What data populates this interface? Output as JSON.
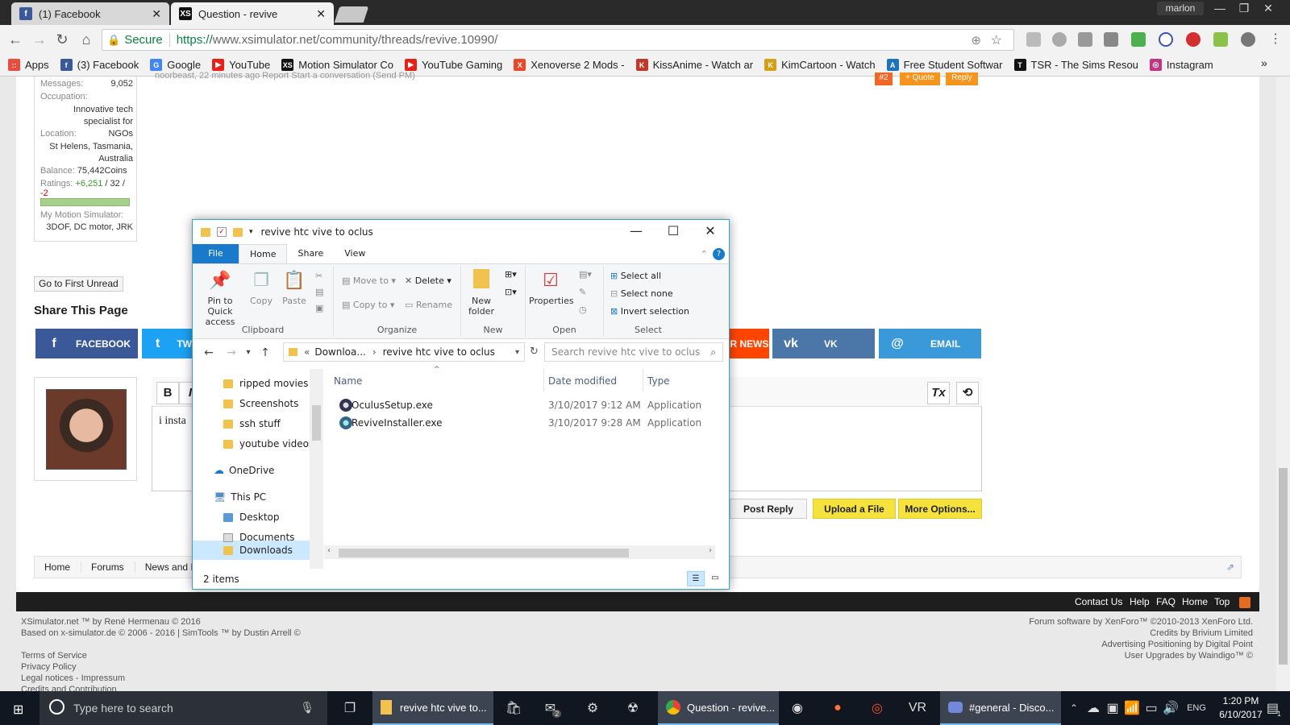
{
  "browser": {
    "tabs": [
      {
        "title": "(1) Facebook",
        "icon": "facebook-icon",
        "color": "#3b5998"
      },
      {
        "title": "Question - revive",
        "icon": "xs-icon",
        "color": "#111111"
      }
    ],
    "user": "marlon",
    "secure_label": "Secure",
    "url_scheme": "https://",
    "url_rest": "www.xsimulator.net/community/threads/revive.10990/",
    "bookmarks": [
      {
        "label": "Apps",
        "color": "#e74c3c",
        "mark": "::"
      },
      {
        "label": "(3) Facebook",
        "color": "#3b5998",
        "mark": "f"
      },
      {
        "label": "Google",
        "color": "#4285f4",
        "mark": "G"
      },
      {
        "label": "YouTube",
        "color": "#e62117",
        "mark": "▶"
      },
      {
        "label": "Motion Simulator Co",
        "color": "#111111",
        "mark": "XS"
      },
      {
        "label": "YouTube Gaming",
        "color": "#e62117",
        "mark": "▶"
      },
      {
        "label": "Xenoverse 2 Mods - ",
        "color": "#e8492b",
        "mark": "X"
      },
      {
        "label": "KissAnime - Watch ar",
        "color": "#c0392b",
        "mark": "K"
      },
      {
        "label": "KimCartoon - Watch",
        "color": "#d4a017",
        "mark": "K"
      },
      {
        "label": "Free Student Softwar",
        "color": "#1e73be",
        "mark": "A"
      },
      {
        "label": "TSR - The Sims Resou",
        "color": "#111111",
        "mark": "T"
      },
      {
        "label": "Instagram",
        "color": "#c13584",
        "mark": "◎"
      }
    ],
    "more": "»"
  },
  "userinfo": {
    "messages_k": "Messages:",
    "messages_v": "9,052",
    "occupation_k": "Occupation:",
    "occupation_v": "Innovative tech specialist for NGOs",
    "location_k": "Location:",
    "location_v": "St Helens, Tasmania, Australia",
    "balance_k": "Balance:",
    "balance_v": "75,442Coins",
    "ratings_k": "Ratings:",
    "ratings_pos": "+6,251",
    "ratings_mid": " / 32 / ",
    "ratings_neg": "-2",
    "sim_k": "My Motion Simulator:",
    "sim_v": "3DOF, DC motor, JRK"
  },
  "post": {
    "meta": "noorbeast, 22 minutes ago   Report   Start a conversation (Send PM)",
    "number": "#2",
    "quote": "+ Quote",
    "reply": "Reply"
  },
  "page": {
    "first_unread": "Go to First Unread",
    "share_title": "Share This Page",
    "share": [
      {
        "label": "FACEBOOK",
        "icon": "f",
        "color": "#3b5998"
      },
      {
        "label": "TW",
        "icon": "t",
        "color": "#1da1f2"
      },
      {
        "label": "R NEWS",
        "icon": "",
        "color": "#ff4500"
      },
      {
        "label": "VK",
        "icon": "vk",
        "color": "#4a76a8"
      },
      {
        "label": "EMAIL",
        "icon": "@",
        "color": "#3a9ad9"
      }
    ],
    "editor_bold": "B",
    "editor_italic": "I",
    "editor_text": "i insta",
    "post_reply": "Post Reply",
    "upload": "Upload a File",
    "more_options": "More Options...",
    "crumbs": [
      "Home",
      "Forums",
      "News and I"
    ],
    "footer_links": [
      "Contact Us",
      "Help",
      "FAQ",
      "Home",
      "Top"
    ],
    "footer_left": [
      "XSimulator.net ™ by René Hermenau © 2016",
      "Based on x-simulator.de © 2006 - 2016 | SimTools ™ by Dustin Arrell ©"
    ],
    "footer_left2": [
      "Terms of Service",
      "Privacy Policy",
      "Legal notices - Impressum",
      "Credits and Contribution"
    ],
    "footer_right": [
      "Forum software by XenForo™ ©2010-2013 XenForo Ltd.",
      "Credits by Brivium Limited",
      "Advertising Positioning by Digital Point",
      "User Upgrades by Waindigo™ ©"
    ]
  },
  "explorer": {
    "title": "revive htc vive to oclus",
    "tabs": [
      "File",
      "Home",
      "Share",
      "View"
    ],
    "ribbon": {
      "pin": "Pin to Quick access",
      "copy": "Copy",
      "paste": "Paste",
      "move_to": "Move to",
      "copy_to": "Copy to",
      "delete": "Delete",
      "rename": "Rename",
      "new_folder": "New folder",
      "properties": "Properties",
      "select_all": "Select all",
      "select_none": "Select none",
      "invert": "Invert selection",
      "groups": [
        "Clipboard",
        "Organize",
        "New",
        "Open",
        "Select"
      ]
    },
    "address": [
      "«",
      "Downloa...",
      "›",
      "revive htc vive to oclus"
    ],
    "search_placeholder": "Search revive htc vive to oclus",
    "nav": [
      "ripped movies",
      "Screenshots",
      "ssh stuff",
      "youtube videos",
      "OneDrive",
      "This PC",
      "Desktop",
      "Documents",
      "Downloads"
    ],
    "columns": [
      "Name",
      "Date modified",
      "Type"
    ],
    "files": [
      {
        "name": "OculusSetup.exe",
        "date": "3/10/2017 9:12 AM",
        "type": "Application"
      },
      {
        "name": "ReviveInstaller.exe",
        "date": "3/10/2017 9:28 AM",
        "type": "Application"
      }
    ],
    "status": "2 items"
  },
  "taskbar": {
    "search": "Type here to search",
    "explorer_app": "revive htc vive to...",
    "chrome_app": "Question - revive...",
    "discord_app": "#general - Disco...",
    "time": "1:20 PM",
    "date": "6/10/2017",
    "mail_badge": "2",
    "notif_badge": "1"
  }
}
